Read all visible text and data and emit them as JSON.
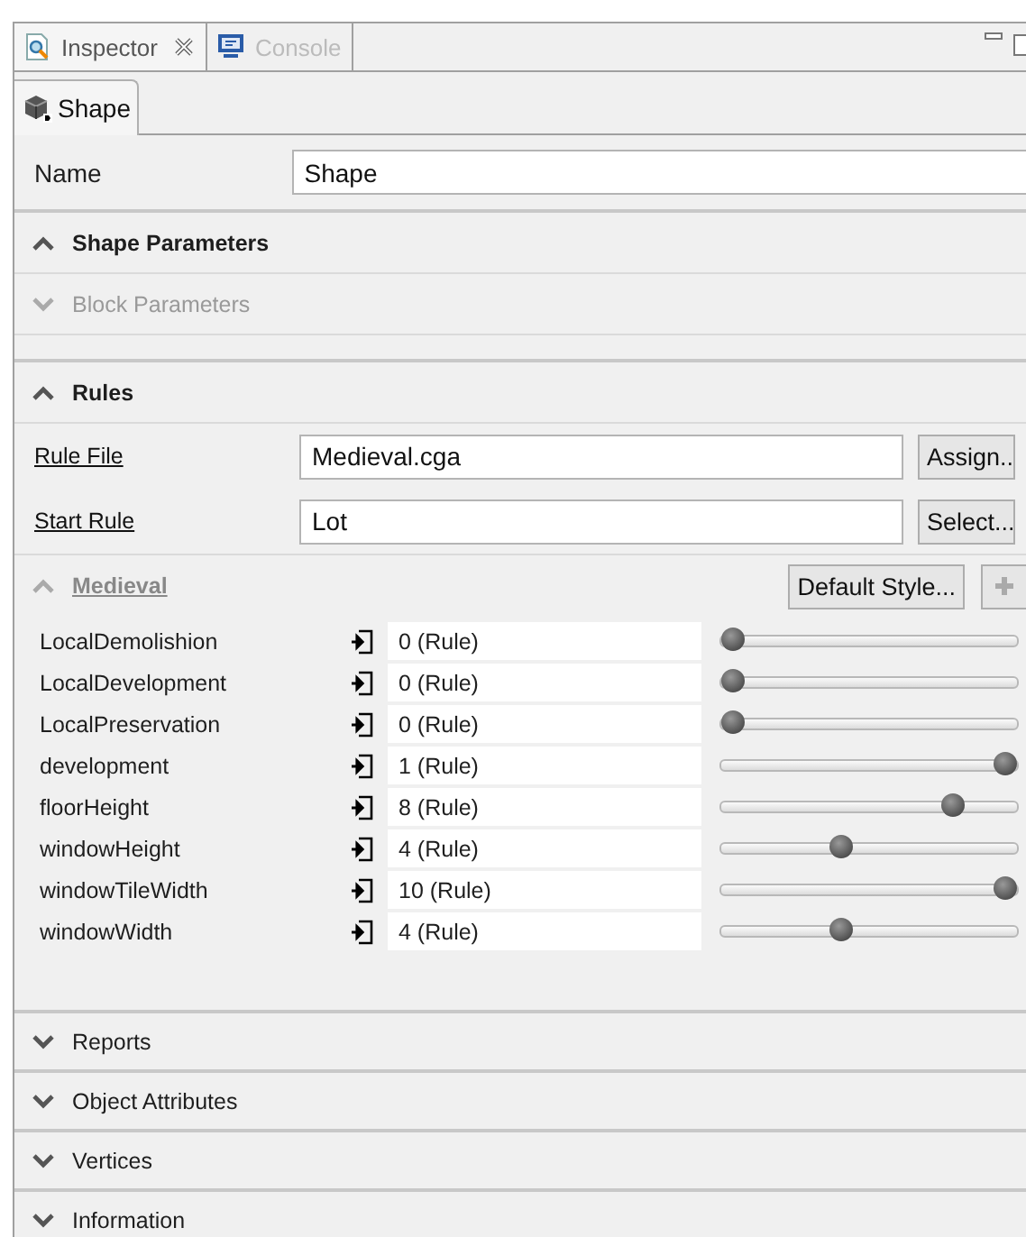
{
  "tabs": [
    {
      "label": "Inspector",
      "selected": true,
      "closable": true
    },
    {
      "label": "Console",
      "selected": false,
      "closable": false
    }
  ],
  "subtab": {
    "label": "Shape"
  },
  "name_field": {
    "label": "Name",
    "value": "Shape"
  },
  "sections": [
    {
      "title": "Shape Parameters",
      "expanded": true,
      "disabled": false
    },
    {
      "title": "Block Parameters",
      "expanded": false,
      "disabled": true
    }
  ],
  "rules": {
    "title": "Rules",
    "expanded": true,
    "fields": [
      {
        "label": "Rule File",
        "value": "Medieval.cga",
        "button": "Assign.."
      },
      {
        "label": "Start Rule",
        "value": "Lot",
        "button": "Select..."
      }
    ]
  },
  "style_group": {
    "title": "Medieval",
    "expanded": true,
    "disabled": true,
    "button": "Default Style..."
  },
  "parameters": [
    {
      "name": "LocalDemolishion",
      "value": "0 (Rule)",
      "level": 0
    },
    {
      "name": "LocalDevelopment",
      "value": "0 (Rule)",
      "level": 0
    },
    {
      "name": "LocalPreservation",
      "value": "0 (Rule)",
      "level": 0
    },
    {
      "name": "development",
      "value": "1 (Rule)",
      "level": 1
    },
    {
      "name": "floorHeight",
      "value": "8 (Rule)",
      "level": 0.81
    },
    {
      "name": "windowHeight",
      "value": "4 (Rule)",
      "level": 0.4
    },
    {
      "name": "windowTileWidth",
      "value": "10 (Rule)",
      "level": 1
    },
    {
      "name": "windowWidth",
      "value": "4 (Rule)",
      "level": 0.4
    }
  ],
  "bottom_sections": [
    {
      "title": "Reports",
      "expanded": false
    },
    {
      "title": "Object Attributes",
      "expanded": false
    },
    {
      "title": "Vertices",
      "expanded": false
    },
    {
      "title": "Information",
      "expanded": false
    }
  ]
}
